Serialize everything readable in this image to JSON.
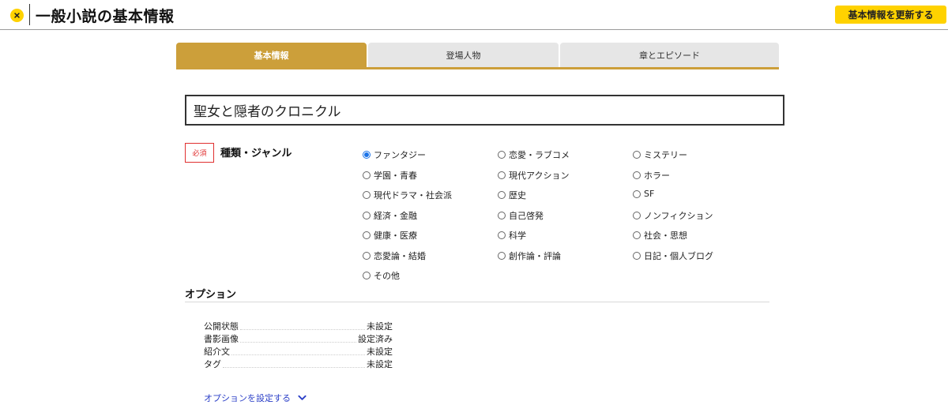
{
  "header": {
    "title": "一般小説の基本情報",
    "update_button": "基本情報を更新する",
    "accent_color": "#ffd200"
  },
  "tabs": [
    {
      "label": "基本情報",
      "active": true
    },
    {
      "label": "登場人物",
      "active": false
    },
    {
      "label": "章とエピソード",
      "active": false
    }
  ],
  "work_title": {
    "value": "聖女と隠者のクロニクル"
  },
  "genre": {
    "required_badge": "必須",
    "label": "種類・ジャンル",
    "selected": "ファンタジー",
    "options": [
      "ファンタジー",
      "恋愛・ラブコメ",
      "ミステリー",
      "学園・青春",
      "現代アクション",
      "ホラー",
      "現代ドラマ・社会派",
      "歴史",
      "SF",
      "経済・金融",
      "自己啓発",
      "ノンフィクション",
      "健康・医療",
      "科学",
      "社会・思想",
      "恋愛論・結婚",
      "創作論・評論",
      "日記・個人ブログ",
      "その他"
    ]
  },
  "options_section": {
    "heading": "オプション",
    "rows": [
      {
        "label": "公開状態",
        "value": "未設定"
      },
      {
        "label": "書影画像",
        "value": "設定済み"
      },
      {
        "label": "紹介文",
        "value": "未設定"
      },
      {
        "label": "タグ",
        "value": "未設定"
      }
    ],
    "link_label": "オプションを設定する"
  }
}
